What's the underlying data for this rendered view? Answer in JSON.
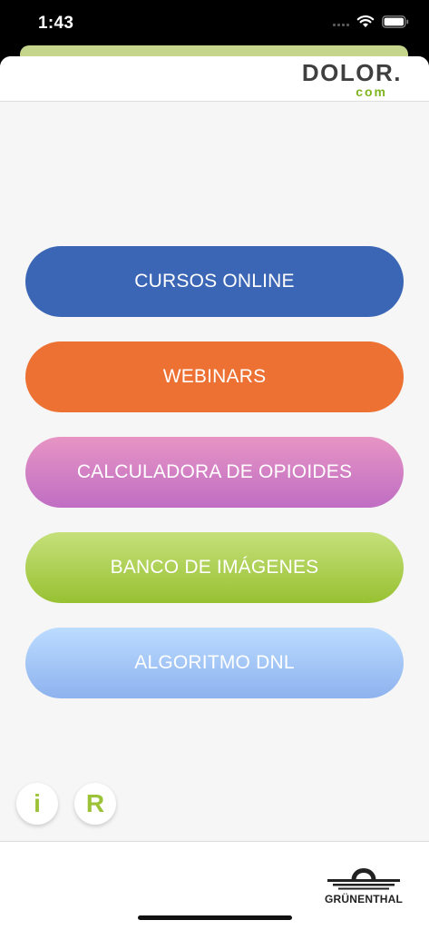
{
  "status_bar": {
    "time": "1:43"
  },
  "header": {
    "logo_main": "DOLOR.",
    "logo_sub": "com"
  },
  "menu": {
    "cursos": "CURSOS ONLINE",
    "webinars": "WEBINARS",
    "calculadora": "CALCULADORA DE OPIOIDES",
    "banco": "BANCO DE IMÁGENES",
    "algoritmo": "ALGORITMO DNL"
  },
  "bottom_buttons": {
    "info": "i",
    "r": "R"
  },
  "footer": {
    "brand": "GRÜNENTHAL"
  },
  "colors": {
    "cursos": "#3b66b5",
    "webinars": "#ec7133",
    "calculadora": "#d57fc4",
    "banco": "#b0d054",
    "algoritmo": "#a5c8f6",
    "accent_green": "#7fb51f"
  },
  "icons": {
    "wifi": "wifi-icon",
    "battery": "battery-icon",
    "signal": "signal-icon",
    "brand": "grunenthal-logo-icon"
  }
}
